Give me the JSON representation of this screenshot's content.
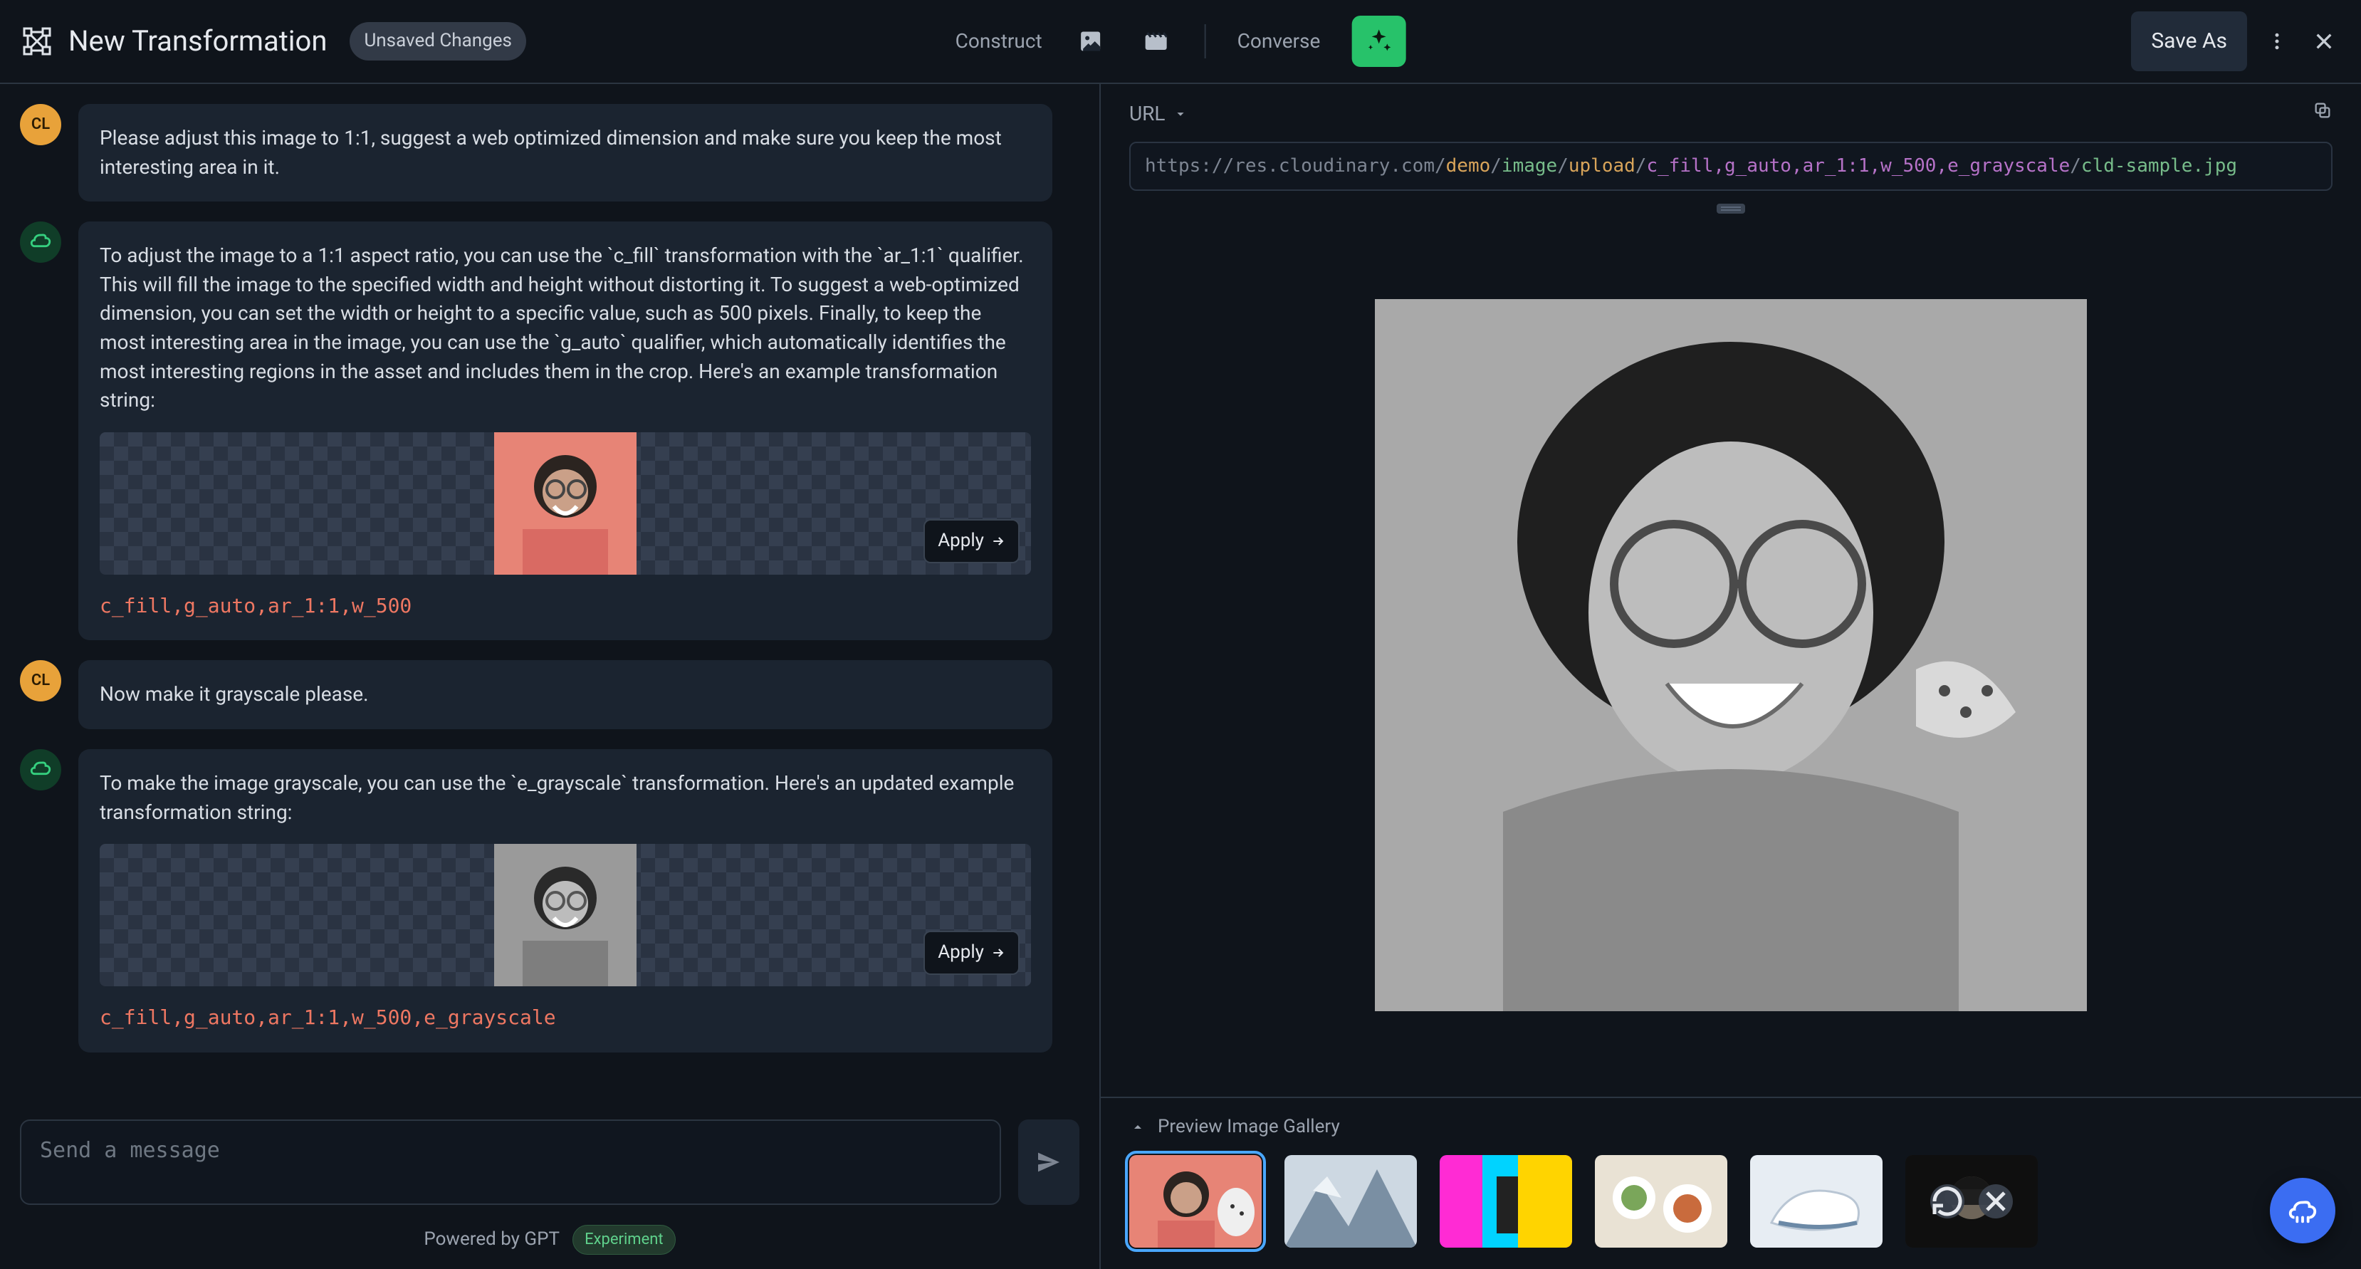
{
  "topbar": {
    "title": "New Transformation",
    "status_pill": "Unsaved Changes",
    "construct_label": "Construct",
    "converse_label": "Converse",
    "save_label": "Save As",
    "icons": {
      "construct_image": "image-icon",
      "construct_video": "film-icon",
      "sparkle": "sparkle-icon",
      "kebab": "kebab-icon",
      "close": "close-icon"
    }
  },
  "chat": {
    "user_initials": "CL",
    "messages": [
      {
        "role": "user",
        "text": "Please adjust this image to 1:1, suggest a web optimized dimension and make sure you keep the most interesting area in it."
      },
      {
        "role": "assistant",
        "text": "To adjust the image to a 1:1 aspect ratio, you can use the `c_fill` transformation with the `ar_1:1` qualifier. This will fill the image to the specified width and height without distorting it. To suggest a web-optimized dimension, you can set the width or height to a specific value, such as 500 pixels. Finally, to keep the most interesting area in the image, you can use the `g_auto` qualifier, which automatically identifies the most interesting regions in the asset and includes them in the crop. Here's an example transformation string:",
        "apply_label": "Apply",
        "code": "c_fill,g_auto,ar_1:1,w_500",
        "thumb_style": "color"
      },
      {
        "role": "user",
        "text": "Now make it grayscale please."
      },
      {
        "role": "assistant",
        "text": "To make the image grayscale, you can use the `e_grayscale` transformation. Here's an updated example transformation string:",
        "apply_label": "Apply",
        "code": "c_fill,g_auto,ar_1:1,w_500,e_grayscale",
        "thumb_style": "gray"
      }
    ]
  },
  "composer": {
    "placeholder": "Send a message"
  },
  "footer": {
    "powered_by": "Powered by GPT",
    "experiment_label": "Experiment"
  },
  "url": {
    "label": "URL",
    "base": "https://res.cloudinary.com/",
    "seg_demo": "demo",
    "seg_image": "image",
    "seg_upload": "upload",
    "seg_transform": "c_fill,g_auto,ar_1:1,w_500,e_grayscale",
    "seg_file": "cld-sample.jpg"
  },
  "gallery": {
    "title": "Preview Image Gallery",
    "selected_index": 0,
    "items": [
      {
        "name": "woman-laughing",
        "palette": [
          "#e78a7a",
          "#2a2420",
          "#f2d9cf"
        ]
      },
      {
        "name": "snowy-mountain",
        "palette": [
          "#dfe7ee",
          "#6a7f93",
          "#b9c8d6"
        ]
      },
      {
        "name": "colorful-collage",
        "palette": [
          "#ff2bd4",
          "#00d3ff",
          "#ffd400"
        ]
      },
      {
        "name": "food-flatlay",
        "palette": [
          "#e9e2d4",
          "#7aa65a",
          "#c96b3d"
        ]
      },
      {
        "name": "white-sneaker",
        "palette": [
          "#eef2f6",
          "#cfd8e2",
          "#6b89a6"
        ]
      },
      {
        "name": "woman-headphones",
        "palette": [
          "#1c1c1c",
          "#c9b9a3",
          "#6a5342"
        ]
      }
    ]
  }
}
